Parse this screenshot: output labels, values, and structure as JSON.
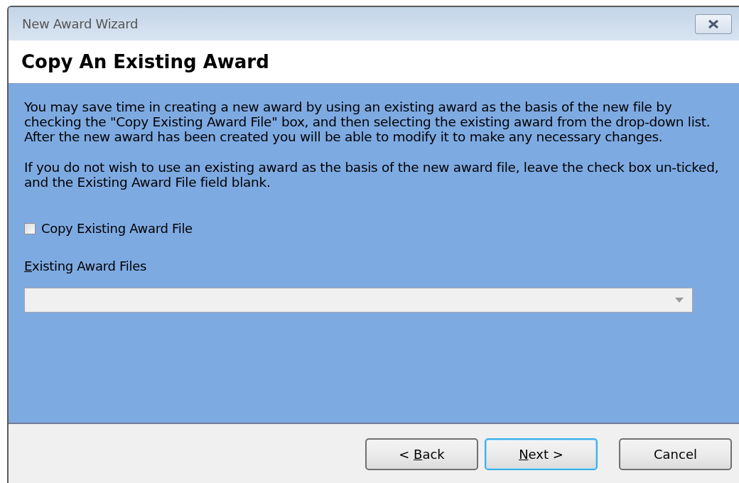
{
  "window": {
    "title": "New Award Wizard"
  },
  "header": {
    "title": "Copy An Existing Award"
  },
  "body": {
    "paragraphs": [
      "You may save time in creating a new award by using an existing award as the basis of the new file by checking the \"Copy Existing Award File\" box, and then selecting the existing award from the drop-down list. After the new award has been created you will be able to modify it to make any necessary changes.",
      "If you do not wish to use an existing award as the basis of the new award file, leave the check box un-ticked, and the Existing Award File field blank."
    ],
    "checkbox": {
      "label": "Copy Existing Award File",
      "checked": false
    },
    "files_label": {
      "key": "E",
      "after": "xisting Award Files"
    },
    "files_combo": {
      "disabled": true
    }
  },
  "buttons": [
    {
      "before": "< ",
      "key": "B",
      "after": "ack",
      "selected": false
    },
    {
      "key": "N",
      "after": "ext >",
      "selected": true
    },
    {
      "before": "Cancel",
      "selected": false
    }
  ]
}
